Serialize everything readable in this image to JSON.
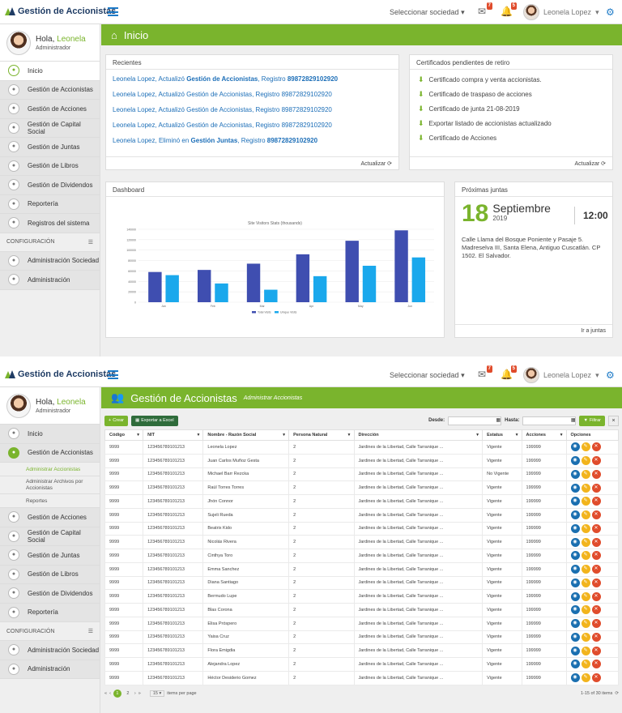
{
  "app": {
    "name": "Gestión de Accionistas",
    "company_select": "Seleccionar sociedad",
    "mail_count": "7",
    "bell_count": "5",
    "user_name": "Leonela Lopez"
  },
  "sidebar": {
    "greeting": "Hola,",
    "greeting_name": "Leonela",
    "role": "Administrador",
    "config_label": "CONFIGURACIÓN"
  },
  "screen1": {
    "nav": [
      "Inicio",
      "Gestión de Accionistas",
      "Gestión de Acciones",
      "Gestión de Capital Social",
      "Gestión de Juntas",
      "Gestión de Libros",
      "Gestión de Dividendos",
      "Reportería",
      "Registros del sistema"
    ],
    "config_nav": [
      "Administración Sociedad",
      "Administración"
    ],
    "page_title": "Inicio",
    "recientes": {
      "title": "Recientes",
      "items": [
        {
          "pre": "Leonela Lopez, Actualizó ",
          "strong": "Gestión de Accionistas",
          "mid": ", Registro ",
          "reg": "89872829102920"
        },
        {
          "pre": "Leonela Lopez, Actualizó Gestión de Accionistas, Registro 89872829102920",
          "strong": "",
          "mid": "",
          "reg": ""
        },
        {
          "pre": "Leonela Lopez, Actualizó Gestión de Accionistas, Registro 89872829102920",
          "strong": "",
          "mid": "",
          "reg": ""
        },
        {
          "pre": "Leonela Lopez, Actualizó Gestión de Accionistas, Registro 89872829102920",
          "strong": "",
          "mid": "",
          "reg": ""
        },
        {
          "pre": "Leonela Lopez, Eliminó en ",
          "strong": "Gestión Juntas",
          "mid": ", Registro ",
          "reg": "89872829102920"
        }
      ],
      "refresh": "Actualizar"
    },
    "certificados": {
      "title": "Certificados pendientes de retiro",
      "items": [
        "Certificado compra y venta accionistas.",
        "Certificado de traspaso de acciones",
        "Certificado de junta 21-08-2019",
        "Exportar listado de accionistas actualizado",
        "Certificado de Acciones"
      ],
      "refresh": "Actualizar"
    },
    "dashboard": {
      "title": "Dashboard",
      "link": "Ir a juntas"
    },
    "juntas": {
      "title": "Próximas juntas",
      "day": "18",
      "month": "Septiembre",
      "year": "2019",
      "time": "12:00",
      "address": "Calle Llama del Bosque Poniente y Pasaje 5. Madreselva III, Santa Elena, Antiguo Cuscatlán. CP 1502. El Salvador.",
      "link": "Ir a juntas"
    }
  },
  "chart_data": {
    "type": "bar",
    "title": "Site Visitors Stats (thousands)",
    "categories": [
      "Jan",
      "Feb",
      "Mar",
      "Apr",
      "May",
      "Jun"
    ],
    "ylim": [
      0,
      140000
    ],
    "yticks": [
      "0",
      "20000",
      "40000",
      "60000",
      "80000",
      "100000",
      "120000",
      "140000"
    ],
    "series": [
      {
        "name": "Total Visits",
        "color": "#3f4eb0",
        "values": [
          58000,
          62000,
          74000,
          92000,
          118000,
          138000
        ]
      },
      {
        "name": "Unique Visits",
        "color": "#1aa8ec",
        "values": [
          52000,
          36000,
          24000,
          50000,
          70000,
          86000
        ]
      }
    ]
  },
  "screen2": {
    "nav_top": [
      "Inicio",
      "Gestión de Accionistas"
    ],
    "sub": [
      "Administrar Accionistas",
      "Administrar Archivos por Accionistas",
      "Reportes"
    ],
    "nav_rest": [
      "Gestión de Acciones",
      "Gestión de Capital Social",
      "Gestión de Juntas",
      "Gestión de Libros",
      "Gestión de Dividendos",
      "Reportería"
    ],
    "config_nav": [
      "Administración Sociedad",
      "Administración"
    ],
    "page_title": "Gestión de Accionistas",
    "page_sub": "Administrar Accionistas",
    "toolbar": {
      "create": "Crear",
      "export": "Exportar a Excel",
      "from": "Desde:",
      "to": "Hasta:",
      "filter": "Filtrar"
    },
    "columns": [
      "Código",
      "NIT",
      "Nombre - Razón Social",
      "Persona Natural",
      "Dirección",
      "Estatus",
      "Acciones",
      "Opciones"
    ],
    "rows": [
      [
        "9999",
        "123456789101213",
        "Leonela Lopez",
        "2",
        "Jardines de la Libertad, Calle Tarranique ...",
        "Vigente",
        "199999"
      ],
      [
        "9999",
        "123456789101213",
        "Juan Carlos Muñoz Gesta",
        "2",
        "Jardines de la Libertad, Calle Tarranique ...",
        "Vigente",
        "199999"
      ],
      [
        "9999",
        "123456789101213",
        "Michael Barr Rezcka",
        "2",
        "Jardines de la Libertad, Calle Tarranique ...",
        "No Vigente",
        "199999"
      ],
      [
        "9999",
        "123456789101213",
        "Raúl Torres Torres",
        "2",
        "Jardines de la Libertad, Calle Tarranique ...",
        "Vigente",
        "199999"
      ],
      [
        "9999",
        "123456789101213",
        "Jhón Connor",
        "2",
        "Jardines de la Libertad, Calle Tarranique ...",
        "Vigente",
        "199999"
      ],
      [
        "9999",
        "123456789101213",
        "Sujeli Rueda",
        "2",
        "Jardines de la Libertad, Calle Tarranique ...",
        "Vigente",
        "199999"
      ],
      [
        "9999",
        "123456789101213",
        "Beatrix Kido",
        "2",
        "Jardines de la Libertad, Calle Tarranique ...",
        "Vigente",
        "199999"
      ],
      [
        "9999",
        "123456789101213",
        "Nicolás Rivera",
        "2",
        "Jardines de la Libertad, Calle Tarranique ...",
        "Vigente",
        "199999"
      ],
      [
        "9999",
        "123456789101213",
        "Cinthya Toro",
        "2",
        "Jardines de la Libertad, Calle Tarranique ...",
        "Vigente",
        "199999"
      ],
      [
        "9999",
        "123456789101213",
        "Emma Sanchez",
        "2",
        "Jardines de la Libertad, Calle Tarranique ...",
        "Vigente",
        "199999"
      ],
      [
        "9999",
        "123456789101213",
        "Diana Santiago",
        "2",
        "Jardines de la Libertad, Calle Tarranique ...",
        "Vigente",
        "199999"
      ],
      [
        "9999",
        "123456789101213",
        "Bermudo Lupe",
        "2",
        "Jardines de la Libertad, Calle Tarranique ...",
        "Vigente",
        "199999"
      ],
      [
        "9999",
        "123456789101213",
        "Blas Corona",
        "2",
        "Jardines de la Libertad, Calle Tarranique ...",
        "Vigente",
        "199999"
      ],
      [
        "9999",
        "123456789101213",
        "Elisa Próspero",
        "2",
        "Jardines de la Libertad, Calle Tarranique ...",
        "Vigente",
        "199999"
      ],
      [
        "9999",
        "123456789101213",
        "Yaisa Cruz",
        "2",
        "Jardines de la Libertad, Calle Tarranique ...",
        "Vigente",
        "199999"
      ],
      [
        "9999",
        "123456789101213",
        "Flora Emigdia",
        "2",
        "Jardines de la Libertad, Calle Tarranique ...",
        "Vigente",
        "199999"
      ],
      [
        "9999",
        "123456789101213",
        "Alejandra Lopez",
        "2",
        "Jardines de la Libertad, Calle Tarranique ...",
        "Vigente",
        "199999"
      ],
      [
        "9999",
        "123456789101213",
        "Héctor Desiderio Gomez",
        "2",
        "Jardines de la Libertad, Calle Tarranique ...",
        "Vigente",
        "199999"
      ]
    ],
    "pager": {
      "pages": [
        "1",
        "2"
      ],
      "per_page": "15",
      "per_page_label": "items per page",
      "summary": "1-15 of 30 items"
    }
  }
}
